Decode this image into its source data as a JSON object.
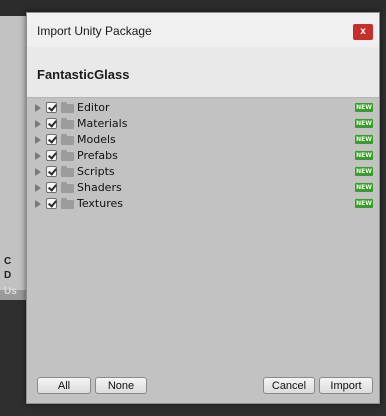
{
  "background": {
    "fragment_1": "C",
    "fragment_2": "D",
    "fragment_3": "Us"
  },
  "dialog": {
    "title": "Import Unity Package",
    "close_glyph": "x",
    "package_name": "FantasticGlass",
    "items": [
      {
        "label": "Editor",
        "checked": true,
        "badge": "NEW"
      },
      {
        "label": "Materials",
        "checked": true,
        "badge": "NEW"
      },
      {
        "label": "Models",
        "checked": true,
        "badge": "NEW"
      },
      {
        "label": "Prefabs",
        "checked": true,
        "badge": "NEW"
      },
      {
        "label": "Scripts",
        "checked": true,
        "badge": "NEW"
      },
      {
        "label": "Shaders",
        "checked": true,
        "badge": "NEW"
      },
      {
        "label": "Textures",
        "checked": true,
        "badge": "NEW"
      }
    ],
    "buttons": {
      "all": "All",
      "none": "None",
      "cancel": "Cancel",
      "import": "Import"
    }
  },
  "colors": {
    "close_button": "#c7302a",
    "new_badge": "#3c9b2f"
  }
}
